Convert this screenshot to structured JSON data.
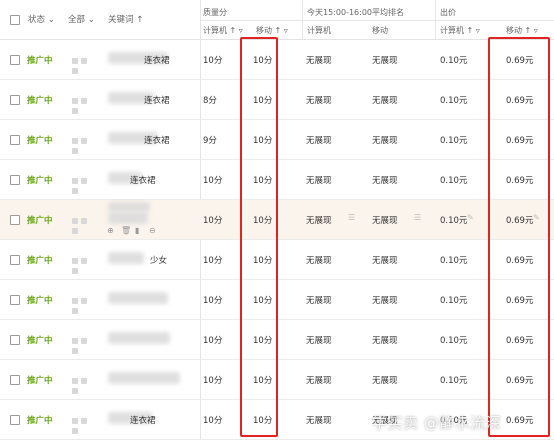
{
  "header": {
    "status_label": "状态",
    "all_label": "全部",
    "keyword_label": "关键词",
    "quality_group": "质量分",
    "rank_group": "今天15:00-16:00平均排名",
    "bid_group": "出价",
    "computer_label": "计算机",
    "mobile_label": "移动"
  },
  "rows": [
    {
      "status": "推广中",
      "keyword": "连衣裙",
      "q_pc": "10分",
      "q_mobile": "10分",
      "rank_pc": "无展现",
      "rank_mobile": "无展现",
      "bid_pc": "0.10元",
      "bid_mobile": "0.69元"
    },
    {
      "status": "推广中",
      "keyword": "连衣裙",
      "q_pc": "8分",
      "q_mobile": "10分",
      "rank_pc": "无展现",
      "rank_mobile": "无展现",
      "bid_pc": "0.10元",
      "bid_mobile": "0.69元"
    },
    {
      "status": "推广中",
      "keyword": "连衣裙",
      "q_pc": "9分",
      "q_mobile": "10分",
      "rank_pc": "无展现",
      "rank_mobile": "无展现",
      "bid_pc": "0.10元",
      "bid_mobile": "0.69元"
    },
    {
      "status": "推广中",
      "keyword": "连衣裙",
      "q_pc": "10分",
      "q_mobile": "10分",
      "rank_pc": "无展现",
      "rank_mobile": "无展现",
      "bid_pc": "0.10元",
      "bid_mobile": "0.69元"
    },
    {
      "status": "推广中",
      "keyword": "",
      "q_pc": "10分",
      "q_mobile": "10分",
      "rank_pc": "无展现",
      "rank_mobile": "无展现",
      "bid_pc": "0.10元",
      "bid_mobile": "0.69元"
    },
    {
      "status": "推广中",
      "keyword": "少女",
      "q_pc": "10分",
      "q_mobile": "10分",
      "rank_pc": "无展现",
      "rank_mobile": "无展现",
      "bid_pc": "0.10元",
      "bid_mobile": "0.69元"
    },
    {
      "status": "推广中",
      "keyword": "",
      "q_pc": "10分",
      "q_mobile": "10分",
      "rank_pc": "无展现",
      "rank_mobile": "无展现",
      "bid_pc": "0.10元",
      "bid_mobile": "0.69元"
    },
    {
      "status": "推广中",
      "keyword": "",
      "q_pc": "10分",
      "q_mobile": "10分",
      "rank_pc": "无展现",
      "rank_mobile": "无展现",
      "bid_pc": "0.10元",
      "bid_mobile": "0.69元"
    },
    {
      "status": "推广中",
      "keyword": "",
      "q_pc": "10分",
      "q_mobile": "10分",
      "rank_pc": "无展现",
      "rank_mobile": "无展现",
      "bid_pc": "0.10元",
      "bid_mobile": "0.69元"
    },
    {
      "status": "推广中",
      "keyword": "连衣裙",
      "q_pc": "10分",
      "q_mobile": "10分",
      "rank_pc": "无展现",
      "rank_mobile": "无展现",
      "bid_pc": "0.10元",
      "bid_mobile": "0.69元"
    }
  ],
  "watermark": "学买卖 @静水流深",
  "colors": {
    "status": "#6aa51c",
    "highlight_row": "#fbf4ec",
    "annotation_box": "#e02424"
  }
}
